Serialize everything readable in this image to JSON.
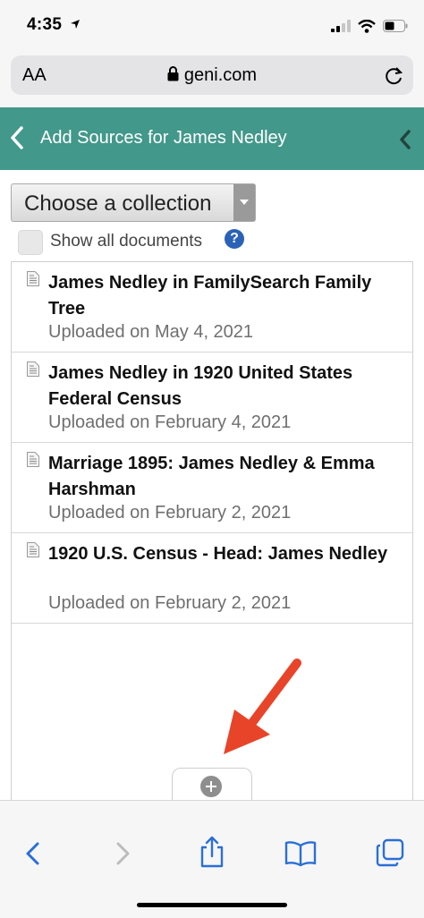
{
  "status": {
    "time": "4:35"
  },
  "browser": {
    "text_size_label": "AA",
    "domain": "geni.com"
  },
  "header": {
    "title": "Add Sources for James Nedley"
  },
  "controls": {
    "collection_select": "Choose a collection",
    "show_all_label": "Show all documents",
    "help_label": "?"
  },
  "documents": [
    {
      "title": "James Nedley in FamilySearch Family Tree",
      "uploaded": "Uploaded on May 4, 2021"
    },
    {
      "title": "James Nedley in 1920 United States Federal Census",
      "uploaded": "Uploaded on February 4, 2021"
    },
    {
      "title": "Marriage 1895: James Nedley & Emma Harshman",
      "uploaded": "Uploaded on February 2, 2021"
    },
    {
      "title": "1920 U.S. Census - Head: James Nedley",
      "uploaded": "Uploaded on February 2, 2021"
    }
  ],
  "icons": {
    "status": [
      "location-arrow-icon",
      "signal-icon",
      "wifi-icon",
      "battery-icon"
    ],
    "toolbar": [
      "back-icon",
      "forward-icon",
      "share-icon",
      "bookmarks-icon",
      "tabs-icon"
    ]
  },
  "colors": {
    "header_bg": "#42988a",
    "toolbar_accent": "#2a6fd6",
    "annotation_arrow": "#e8442a",
    "help_icon": "#2a62b7"
  }
}
